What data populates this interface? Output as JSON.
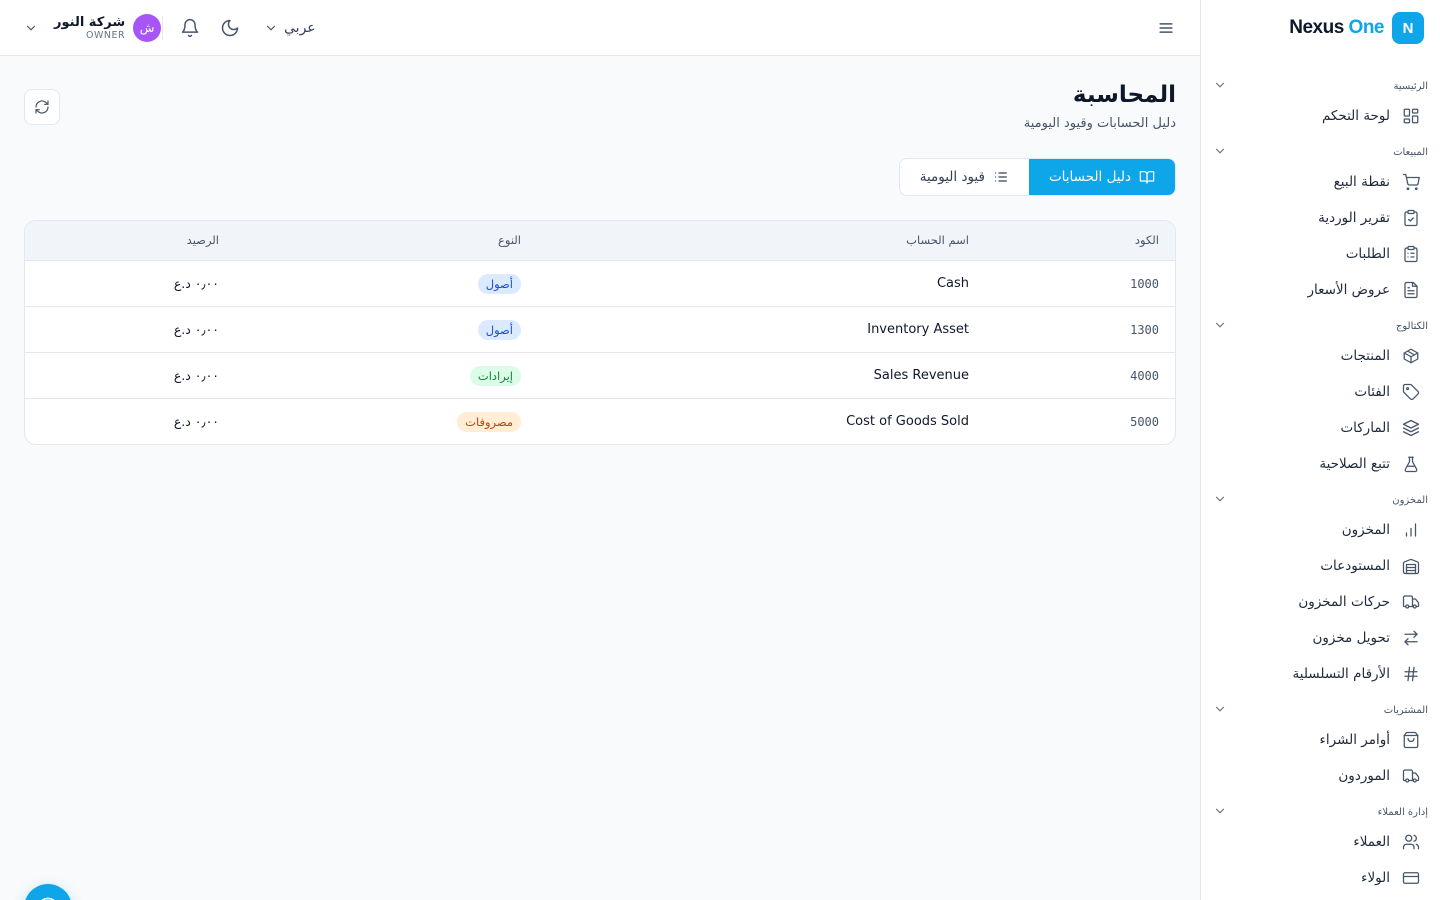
{
  "brand": {
    "logo_letter": "N",
    "name_main": "Nexus",
    "name_accent": "One",
    "accent_color": "#0ea5e9"
  },
  "sidebar": {
    "sections": [
      {
        "title": "الرئيسية",
        "items": [
          {
            "label": "لوحة التحكم",
            "icon": "grid-icon"
          }
        ]
      },
      {
        "title": "المبيعات",
        "items": [
          {
            "label": "نقطة البيع",
            "icon": "cart-icon"
          },
          {
            "label": "تقرير الوردية",
            "icon": "clipboard-check-icon"
          },
          {
            "label": "الطلبات",
            "icon": "clipboard-list-icon"
          },
          {
            "label": "عروض الأسعار",
            "icon": "file-text-icon"
          }
        ]
      },
      {
        "title": "الكتالوج",
        "items": [
          {
            "label": "المنتجات",
            "icon": "package-icon"
          },
          {
            "label": "الفئات",
            "icon": "tag-icon"
          },
          {
            "label": "الماركات",
            "icon": "layers-icon"
          },
          {
            "label": "تتبع الصلاحية",
            "icon": "flask-icon"
          }
        ]
      },
      {
        "title": "المخزون",
        "items": [
          {
            "label": "المخزون",
            "icon": "bar-chart-icon"
          },
          {
            "label": "المستودعات",
            "icon": "warehouse-icon"
          },
          {
            "label": "حركات المخزون",
            "icon": "truck-icon"
          },
          {
            "label": "تحويل مخزون",
            "icon": "arrows-swap-icon"
          },
          {
            "label": "الأرقام التسلسلية",
            "icon": "hash-icon"
          }
        ]
      },
      {
        "title": "المشتريات",
        "items": [
          {
            "label": "أوامر الشراء",
            "icon": "shopping-bag-icon"
          },
          {
            "label": "الموردون",
            "icon": "truck-icon"
          }
        ]
      },
      {
        "title": "إدارة العملاء",
        "items": [
          {
            "label": "العملاء",
            "icon": "users-icon"
          },
          {
            "label": "الولاء",
            "icon": "credit-card-icon"
          }
        ]
      }
    ]
  },
  "header": {
    "language": "عربي",
    "user": {
      "name": "شركة النور",
      "role": "OWNER",
      "avatar_letter": "ش",
      "avatar_color": "#a855f7"
    }
  },
  "page": {
    "title": "المحاسبة",
    "subtitle": "دليل الحسابات وقيود اليومية",
    "tabs": [
      {
        "label": "دليل الحسابات",
        "active": true
      },
      {
        "label": "قيود اليومية",
        "active": false
      }
    ]
  },
  "table": {
    "headers": {
      "code": "الكود",
      "name": "اسم الحساب",
      "type": "النوع",
      "balance": "الرصيد"
    },
    "rows": [
      {
        "code": "1000",
        "name": "Cash",
        "type": "أصول",
        "type_kind": "assets",
        "balance": "٠٫٠٠ د.ع"
      },
      {
        "code": "1300",
        "name": "Inventory Asset",
        "type": "أصول",
        "type_kind": "assets",
        "balance": "٠٫٠٠ د.ع"
      },
      {
        "code": "4000",
        "name": "Sales Revenue",
        "type": "إيرادات",
        "type_kind": "revenue",
        "balance": "٠٫٠٠ د.ع"
      },
      {
        "code": "5000",
        "name": "Cost of Goods Sold",
        "type": "مصروفات",
        "type_kind": "expenses",
        "balance": "٠٫٠٠ د.ع"
      }
    ]
  }
}
